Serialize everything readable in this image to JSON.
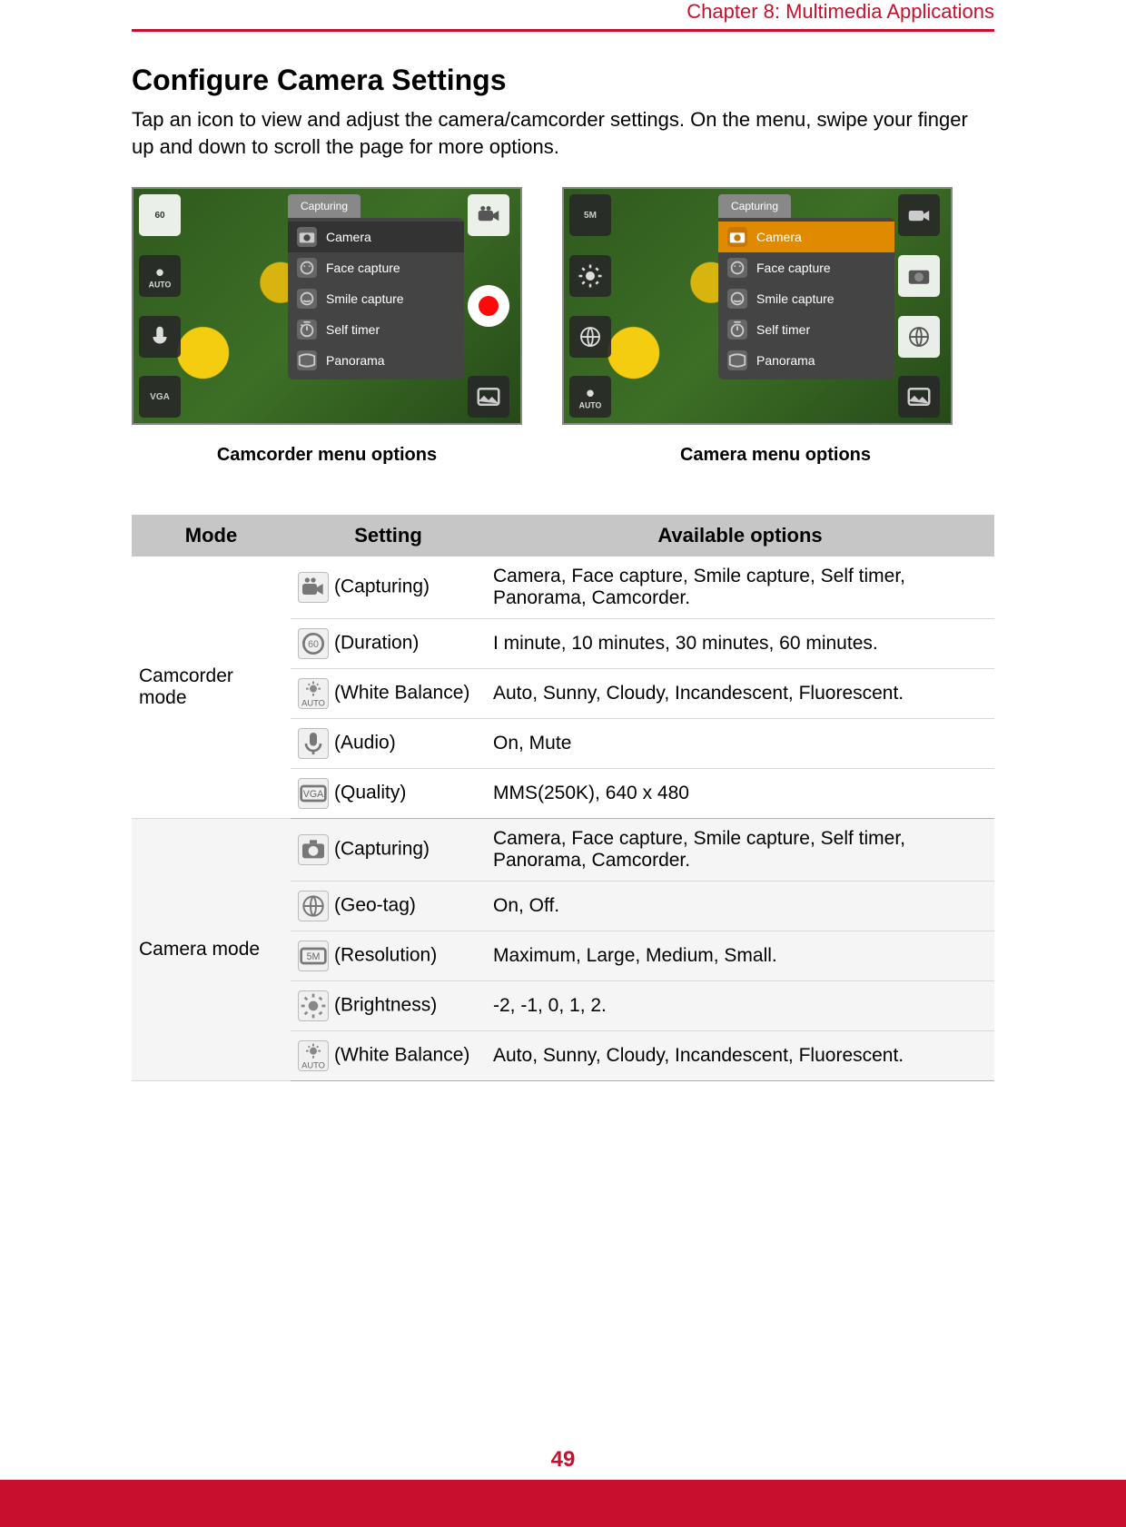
{
  "chapter_header": "Chapter 8: Multimedia Applications",
  "title": "Configure Camera Settings",
  "intro": "Tap an icon to view and adjust the camera/camcorder settings. On the menu, swipe your finger up and down to scroll the page for more options.",
  "shot_left": {
    "caption": "Camcorder menu options",
    "side_left": {
      "a": "60",
      "b": "AUTO",
      "c": "",
      "d": "VGA"
    },
    "menu_tab": "Capturing",
    "menu": [
      "Camera",
      "Face capture",
      "Smile capture",
      "Self timer",
      "Panorama"
    ]
  },
  "shot_right": {
    "caption": "Camera menu options",
    "side_left": {
      "a": "5M",
      "b": "",
      "c": "",
      "d": "AUTO"
    },
    "menu_tab": "Capturing",
    "menu": [
      "Camera",
      "Face capture",
      "Smile capture",
      "Self timer",
      "Panorama"
    ]
  },
  "table": {
    "headers": {
      "mode": "Mode",
      "setting": "Setting",
      "options": "Available options"
    },
    "groups": [
      {
        "mode": "Camcorder mode",
        "rows": [
          {
            "icon": "camcorder",
            "setting": "(Capturing)",
            "options": "Camera, Face capture, Smile capture, Self timer, Panorama, Camcorder."
          },
          {
            "icon": "duration",
            "setting": "(Duration)",
            "options": "I minute, 10 minutes, 30 minutes, 60 minutes."
          },
          {
            "icon": "wb-auto",
            "setting": "(White Balance)",
            "options": "Auto, Sunny, Cloudy, Incandescent, Fluorescent."
          },
          {
            "icon": "mic",
            "setting": "(Audio)",
            "options": "On, Mute"
          },
          {
            "icon": "vga",
            "setting": "(Quality)",
            "options": "MMS(250K), 640 x 480"
          }
        ]
      },
      {
        "mode": "Camera mode",
        "rows": [
          {
            "icon": "camera",
            "setting": "(Capturing)",
            "options": "Camera, Face capture, Smile capture, Self timer, Panorama, Camcorder."
          },
          {
            "icon": "globe",
            "setting": "(Geo-tag)",
            "options": "On, Off."
          },
          {
            "icon": "resolution",
            "setting": "(Resolution)",
            "options": "Maximum, Large, Medium, Small."
          },
          {
            "icon": "brightness",
            "setting": "(Brightness)",
            "options": "-2, -1, 0, 1, 2."
          },
          {
            "icon": "wb-auto",
            "setting": "(White Balance)",
            "options": "Auto, Sunny, Cloudy, Incandescent, Fluorescent."
          }
        ]
      }
    ]
  },
  "page_number": "49"
}
